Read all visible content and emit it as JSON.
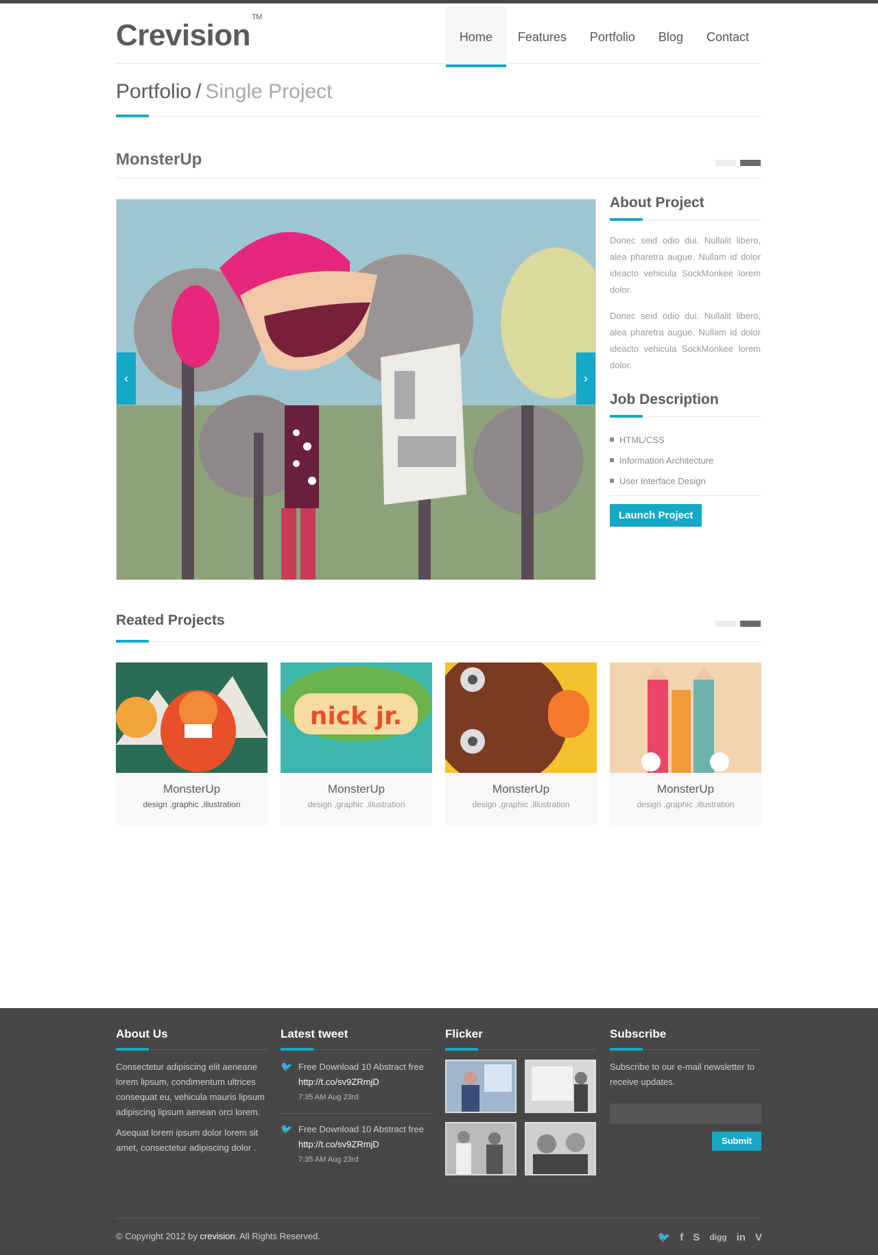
{
  "header": {
    "logo": "Crevision",
    "logo_tm": "TM",
    "nav": [
      "Home",
      "Features",
      "Portfolio",
      "Blog",
      "Contact"
    ]
  },
  "breadcrumb": {
    "parent": "Portfolio",
    "separator": "/",
    "current": "Single Project"
  },
  "project": {
    "title": "MonsterUp",
    "slider_prev": "‹",
    "slider_next": "›"
  },
  "about": {
    "heading": "About Project",
    "paragraphs": [
      "Donec seid odio dui. Nullalit libero, alea pharetra augue. Nullam id dolor ideacto vehicula SockMonkee lorem dolor.",
      "Donec seid odio dui. Nullalit libero, alea pharetra augue. Nullam id dolor ideacto vehicula SockMonkee lorem dolor."
    ]
  },
  "job": {
    "heading": "Job Description",
    "items": [
      "HTML/CSS",
      "Information Architecture",
      "User Interface Design"
    ],
    "button": "Launch Project"
  },
  "related": {
    "heading": "Reated Projects",
    "cards": [
      {
        "title": "MonsterUp",
        "tags": "design ,graphic ,illustration"
      },
      {
        "title": "MonsterUp",
        "tags": "design ,graphic ,illustration"
      },
      {
        "title": "MonsterUp",
        "tags": "design ,graphic ,illustration"
      },
      {
        "title": "MonsterUp",
        "tags": "design ,graphic ,illustration"
      }
    ],
    "thumb2_text": "nick jr."
  },
  "footer": {
    "about": {
      "heading": "About Us",
      "p1": "Consectetur adipiscing elit aeneane lorem lipsum, condimentum ultrices consequat eu, vehicula mauris lipsum adipiscing lipsum aenean orci lorem.",
      "p2": "Asequat lorem ipsum dolor lorem sit amet, consectetur adipiscing dolor ."
    },
    "tweets": {
      "heading": "Latest tweet",
      "items": [
        {
          "text": "Free Download 10 Abstract free",
          "link": "http://t.co/sv9ZRmjD",
          "time": "7:35 AM Aug 23rd"
        },
        {
          "text": "Free Download 10 Abstract free",
          "link": "http://t.co/sv9ZRmjD",
          "time": "7:35 AM Aug 23rd"
        }
      ]
    },
    "flicker": {
      "heading": "Flicker"
    },
    "subscribe": {
      "heading": "Subscribe",
      "text": "Subscribe to our e-mail newsletter to receive updates.",
      "placeholder": "",
      "button": "Submit"
    },
    "copyright_pre": "© Copyright 2012 by",
    "copyright_brand": "crevision",
    "copyright_post": ". All Rights Reserved.",
    "social": {
      "twitter": "🐦",
      "facebook": "f",
      "skype": "S",
      "digg": "digg",
      "linkedin": "in",
      "vimeo": "V"
    }
  },
  "colors": {
    "accent": "#16a8c7",
    "footer_bg": "#474747",
    "text": "#5b5b5b"
  }
}
